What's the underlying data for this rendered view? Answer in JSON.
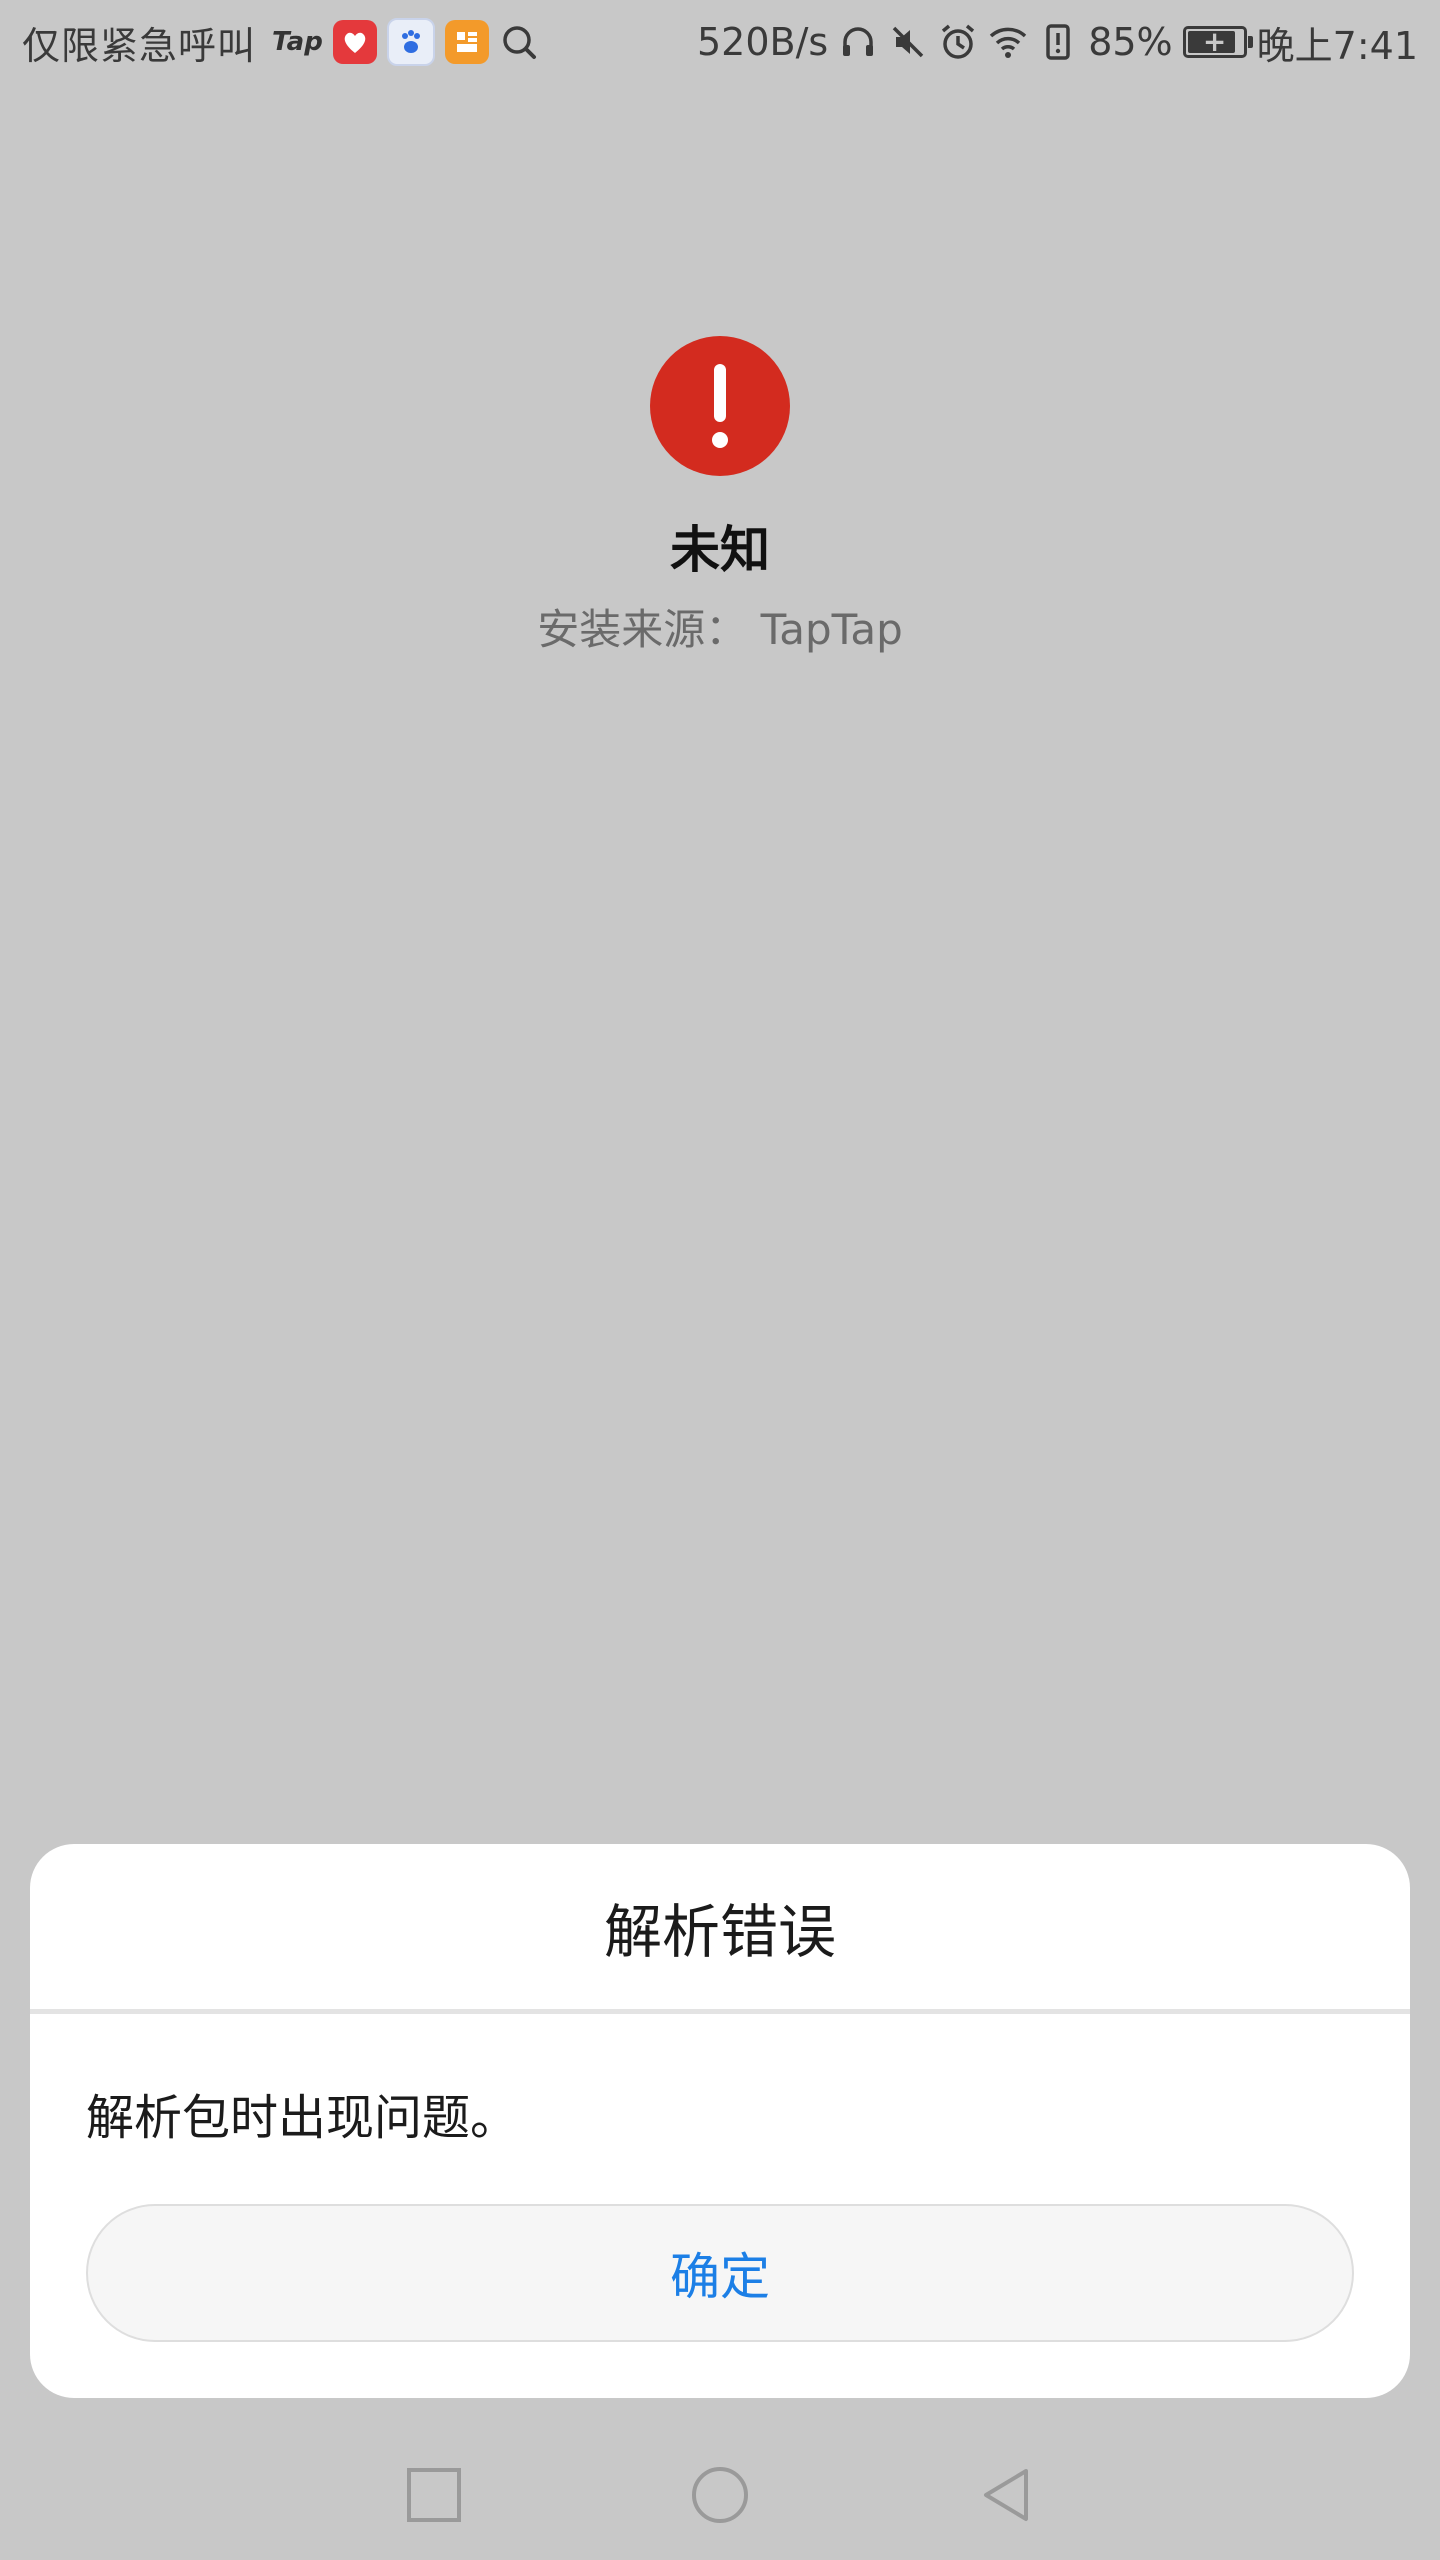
{
  "status_bar": {
    "carrier_text": "仅限紧急呼叫",
    "tap_logo": "Tap",
    "network_speed": "520B/s",
    "battery_percent": "85%",
    "time": "晚上7:41",
    "icons": [
      "taptap-icon",
      "pinduoduo-app-icon",
      "baidu-app-icon",
      "orange-app-icon",
      "search-zoom-icon",
      "headphones-icon",
      "mute-icon",
      "alarm-icon",
      "wifi-icon",
      "battery-alert-icon",
      "battery-icon"
    ]
  },
  "app_info": {
    "name": "未知",
    "install_source": "安装来源： TapTap",
    "icon": "error-exclamation-icon",
    "icon_color": "#d32b1f"
  },
  "dialog": {
    "title": "解析错误",
    "message": "解析包时出现问题。",
    "confirm_label": "确定",
    "confirm_color": "#1c7fe6"
  },
  "nav_bar": {
    "icons": [
      "recent-apps-icon",
      "home-icon",
      "back-icon"
    ]
  }
}
